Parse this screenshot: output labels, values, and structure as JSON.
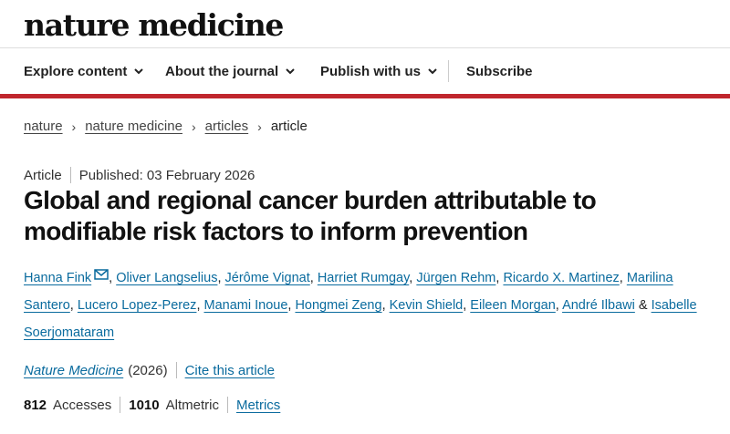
{
  "site": {
    "logo": "nature medicine"
  },
  "nav": {
    "explore": "Explore content",
    "about": "About the journal",
    "publish": "Publish with us",
    "subscribe": "Subscribe"
  },
  "breadcrumb": [
    {
      "label": "nature"
    },
    {
      "label": "nature medicine"
    },
    {
      "label": "articles"
    },
    {
      "label": "article"
    }
  ],
  "article": {
    "type": "Article",
    "published": "Published: 03 February 2026",
    "title": "Global and regional cancer burden attributable to modifiable risk factors to inform prevention",
    "authors": [
      "Hanna Fink",
      "Oliver Langselius",
      "Jérôme Vignat",
      "Harriet Rumgay",
      "Jürgen Rehm",
      "Ricardo X. Martinez",
      "Marilina Santero",
      "Lucero Lopez-Perez",
      "Manami Inoue",
      "Hongmei Zeng",
      "Kevin Shield",
      "Eileen Morgan",
      "André Ilbawi",
      "Isabelle Soerjomataram"
    ],
    "author_and": "&",
    "journal": "Nature Medicine",
    "year": "(2026)",
    "cite_label": "Cite this article"
  },
  "metrics": {
    "accesses_count": "812",
    "accesses_label": "Accesses",
    "altmetric_count": "1010",
    "altmetric_label": "Altmetric",
    "metrics_link": "Metrics"
  },
  "colors": {
    "accent_bar": "#c0262d",
    "link": "#0a6b9e"
  },
  "icons": [
    "chevron-down-icon",
    "chevron-right-icon",
    "mail-icon"
  ]
}
